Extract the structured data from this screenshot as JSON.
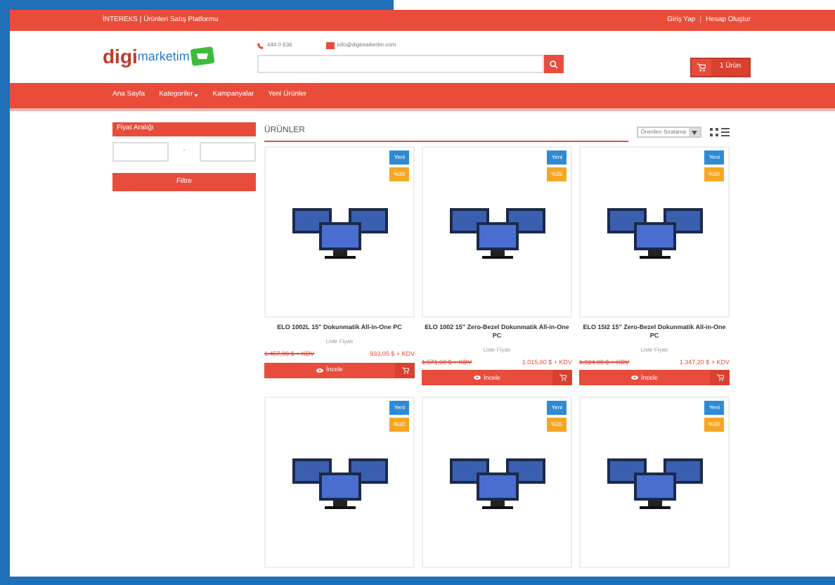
{
  "top_bar": {
    "tagline": "İNTEREKS | Ürünleri Satış Platformu",
    "links": [
      "Giriş Yap",
      "Hesap Oluştur"
    ],
    "separator": "|"
  },
  "header": {
    "logo": {
      "part_1": "digi",
      "part_2": "marketim"
    },
    "phone": "444 0 636",
    "email": "info@digimarketim.com",
    "cart": {
      "label": "1 Ürün"
    }
  },
  "nav": [
    {
      "label": "Ana Sayfa",
      "dropdown": false
    },
    {
      "label": "Kategoriler",
      "dropdown": true
    },
    {
      "label": "Kampanyalar",
      "dropdown": false
    },
    {
      "label": "Yeni Ürünler",
      "dropdown": false
    }
  ],
  "sidebar": {
    "title": "Fiyat Aralığı",
    "separator": "-",
    "button": "Filtre"
  },
  "products_header": {
    "title": "ÜRÜNLER",
    "sort": "Önerilen Sıralama"
  },
  "products": [
    {
      "badges": [
        "Yeni",
        "%30"
      ],
      "title": "ELO 1002L 15\" Dokunmatik All-in-One PC",
      "note": "Liste Fiyatı",
      "old_price": "1.457,00 $ + KDV",
      "price": "933,05 $ + KDV",
      "button": "İncele"
    },
    {
      "badges": [
        "Yeni",
        "%35"
      ],
      "title": "ELO 1002 15\" Zero-Bezel Dokunmatik All-in-One PC",
      "note": "Liste Fiyatı",
      "old_price": "1.571,60 $ + KDV",
      "price": "1.015,80 $ + KDV",
      "button": "İncele"
    },
    {
      "badges": [
        "Yeni",
        "%30"
      ],
      "title": "ELO 15I2 15\" Zero-Bezel Dokunmatik All-in-One PC",
      "note": "Liste Fiyatı",
      "old_price": "1.924,00 $ + KDV",
      "price": "1.347,20 $ + KDV",
      "button": "İncele"
    },
    {
      "badges": [
        "Yeni",
        "%30"
      ]
    },
    {
      "badges": [
        "Yeni",
        "%35"
      ]
    },
    {
      "badges": [
        "Yeni",
        "%30"
      ]
    }
  ]
}
